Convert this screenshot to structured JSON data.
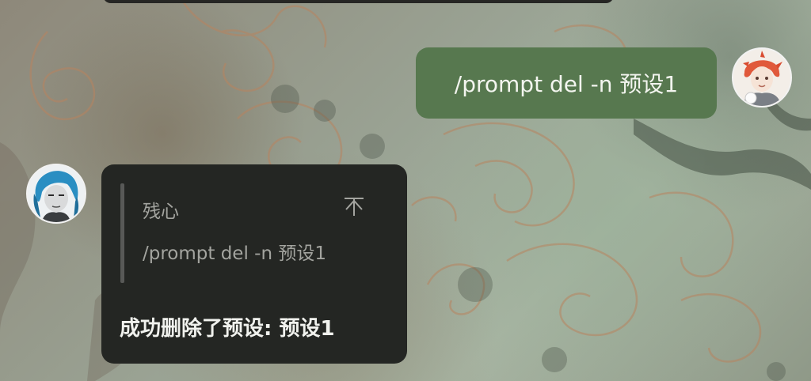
{
  "chat": {
    "outgoing": {
      "text": "/prompt del -n 预设1"
    },
    "incoming": {
      "quote": {
        "author": "残心",
        "text": "/prompt del -n 预设1",
        "jump_icon": "arrow-up-icon"
      },
      "reply": "成功删除了预设: 预设1"
    }
  },
  "colors": {
    "outgoing_bubble": "#57784f",
    "incoming_bubble": "#242623",
    "quote_text": "#a3a49f"
  }
}
